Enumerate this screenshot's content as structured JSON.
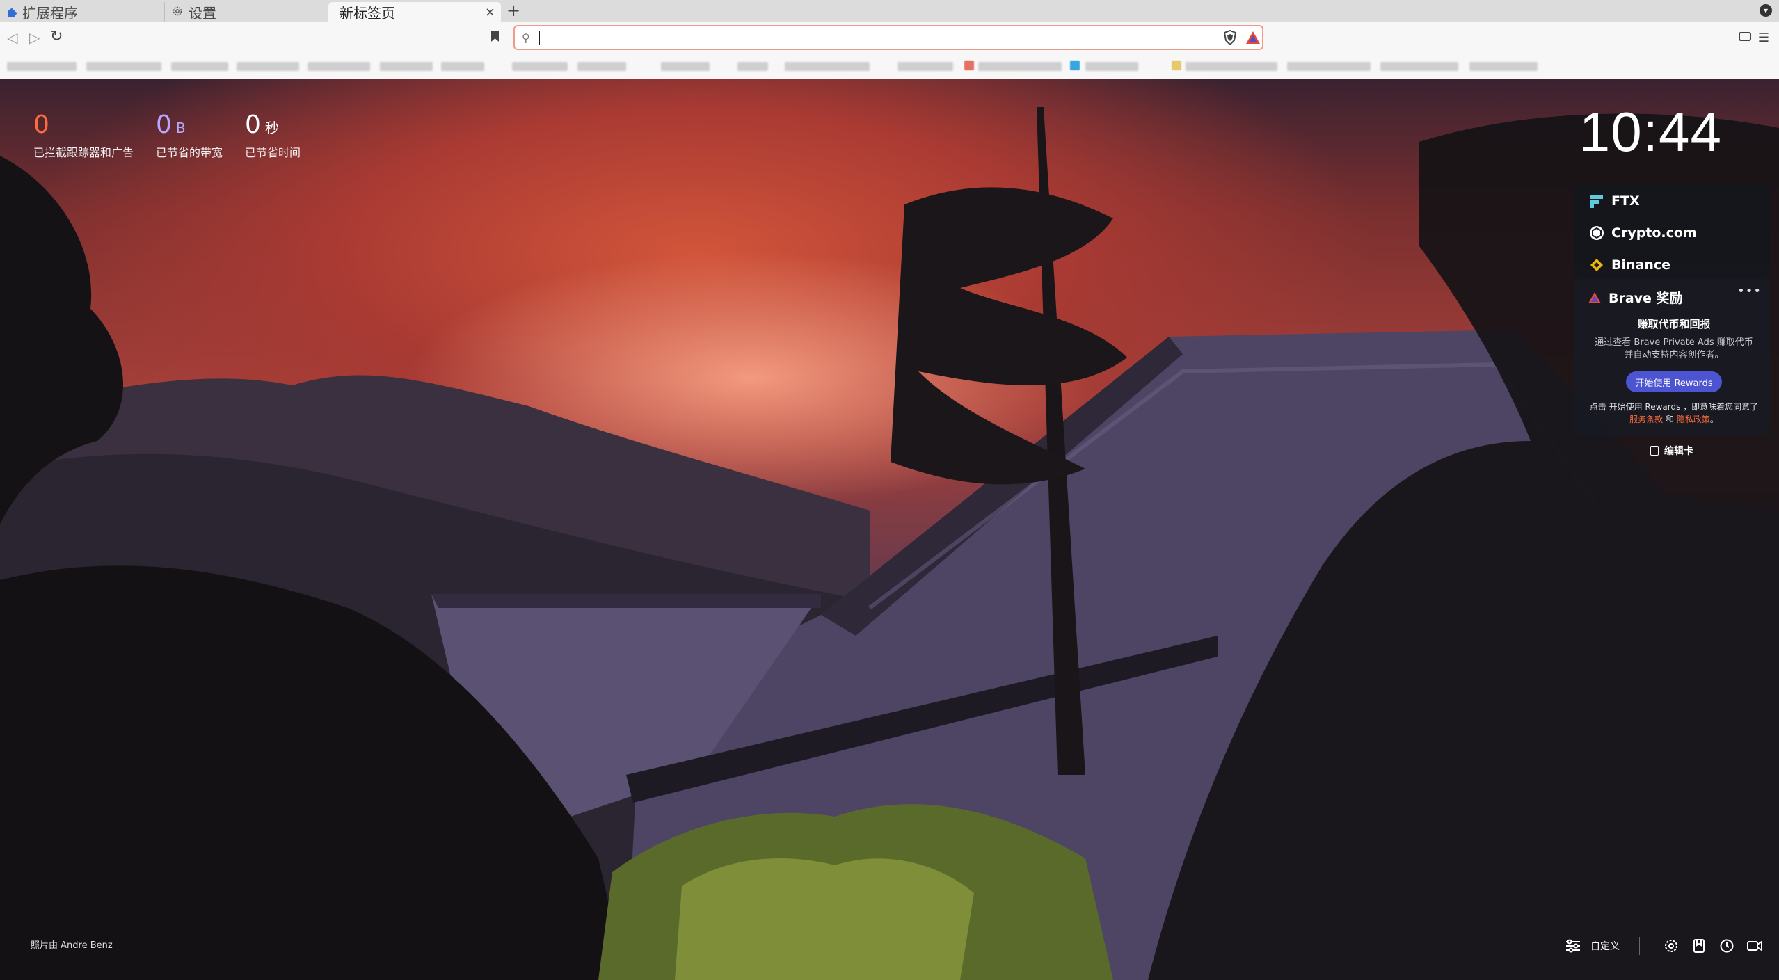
{
  "tabs": [
    {
      "label": "扩展程序",
      "icon": "puzzle-icon"
    },
    {
      "label": "设置",
      "icon": "gear-icon"
    },
    {
      "label": "新标签页",
      "active": true,
      "close": "×"
    }
  ],
  "new_tab_symbol": "+",
  "stats": [
    {
      "value": "0",
      "unit": "",
      "label": "已拦截跟踪器和广告",
      "color": "#ff6a3d"
    },
    {
      "value": "0",
      "unit": "B",
      "label": "已节省的带宽",
      "color": "#b7a7ff"
    },
    {
      "value": "0",
      "unit": "秒",
      "label": "已节省时间",
      "color": "#ffffff"
    }
  ],
  "clock": "10:44",
  "widgets": {
    "ftx": "FTX",
    "crypto_com": "Crypto.com",
    "binance": "Binance",
    "rewards": {
      "title": "Brave 奖励",
      "more": "•••",
      "heading": "赚取代币和回报",
      "description": "通过查看 Brave Private Ads 赚取代币并自动支持内容创作者。",
      "button": "开始使用 Rewards",
      "footer_prefix": "点击 开始使用 Rewards ，即意味着您同意了",
      "terms": "服务条款",
      "and": " 和 ",
      "privacy": "隐私政策",
      "period": "。"
    },
    "edit_cards": "编辑卡"
  },
  "photo_credit": "照片由 Andre Benz",
  "customize": "自定义",
  "colors": {
    "accent": "#4c54d2",
    "brave_orange": "#ff6a3d",
    "omnibox_border": "#f29a8a"
  }
}
